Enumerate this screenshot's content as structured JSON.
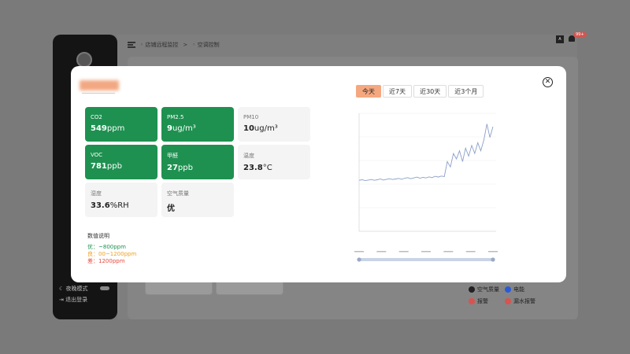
{
  "app": {
    "header": {
      "breadcrumb_1": "店铺远程监控",
      "breadcrumb_sep": ">",
      "breadcrumb_2": "空调控制"
    },
    "notification_badge": "99+",
    "sidebar": {
      "night_mode_label": "夜晚模式",
      "logout_label": "退出登录"
    },
    "legend": [
      {
        "label": "空气质量",
        "color": "#222222"
      },
      {
        "label": "电能",
        "color": "#2a5bd7"
      },
      {
        "label": "报警",
        "color": "#d9534f"
      },
      {
        "label": "漏水报警",
        "color": "#d9534f"
      }
    ]
  },
  "modal": {
    "tiles": [
      {
        "label": "CO2",
        "value": "549",
        "unit": "ppm",
        "status": "green"
      },
      {
        "label": "PM2.5",
        "value": "9",
        "unit": "ug/m³",
        "status": "green"
      },
      {
        "label": "PM10",
        "value": "10",
        "unit": "ug/m³",
        "status": "grey"
      },
      {
        "label": "VOC",
        "value": "781",
        "unit": "ppb",
        "status": "green"
      },
      {
        "label": "甲醛",
        "value": "27",
        "unit": "ppb",
        "status": "green"
      },
      {
        "label": "温度",
        "value": "23.8",
        "unit": "°C",
        "status": "grey"
      },
      {
        "label": "湿度",
        "value": "33.6",
        "unit": "%RH",
        "status": "grey"
      },
      {
        "label": "空气质量",
        "value": "优",
        "unit": "",
        "status": "grey"
      }
    ],
    "description": {
      "title": "数值说明",
      "lines": [
        {
          "text": "优：~800ppm",
          "color": "#1e9150"
        },
        {
          "text": "良：00~1200ppm",
          "color": "#f0a020"
        },
        {
          "text": "差：1200ppm",
          "color": "#e64a3c"
        }
      ]
    },
    "range_tabs": [
      {
        "label": "今天",
        "active": true
      },
      {
        "label": "近7天",
        "active": false
      },
      {
        "label": "近30天",
        "active": false
      },
      {
        "label": "近3个月",
        "active": false
      }
    ],
    "colors": {
      "good": "#1e9150",
      "accent": "#f5a880",
      "line": "#8aa0c8"
    }
  },
  "chart_data": {
    "type": "line",
    "series": [
      {
        "values": [
          490,
          492,
          489,
          491,
          493,
          490,
          492,
          495,
          491,
          494,
          496,
          493,
          495,
          497,
          494,
          498,
          500,
          496,
          499,
          502,
          498,
          501,
          499,
          503,
          500,
          505,
          502,
          506,
          504,
          560,
          540,
          590,
          570,
          600,
          560,
          610,
          580,
          620,
          590,
          630,
          600,
          640,
          700,
          650,
          690
        ]
      }
    ],
    "ylim": [
      300,
      740
    ],
    "grid": true
  }
}
